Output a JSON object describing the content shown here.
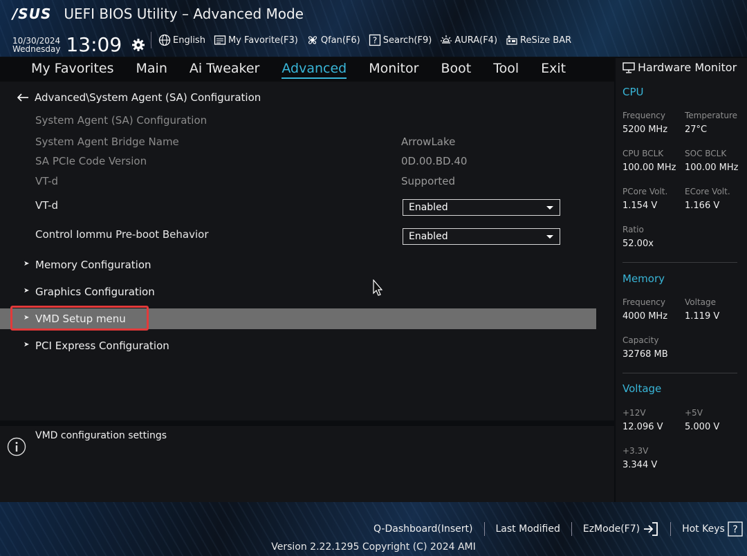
{
  "header": {
    "brand": "/SUS",
    "title": "UEFI BIOS Utility – Advanced Mode",
    "date": "10/30/2024",
    "weekday": "Wednesday",
    "time": "13:09"
  },
  "toolbar": [
    {
      "icon": "globe-icon",
      "label": "English"
    },
    {
      "icon": "favorite-icon",
      "label": "My Favorite(F3)"
    },
    {
      "icon": "fan-icon",
      "label": "Qfan(F6)"
    },
    {
      "icon": "search-icon",
      "label": "Search(F9)"
    },
    {
      "icon": "aura-icon",
      "label": "AURA(F4)"
    },
    {
      "icon": "resize-bar-icon",
      "label": "ReSize BAR"
    }
  ],
  "tabs": [
    "My Favorites",
    "Main",
    "Ai Tweaker",
    "Advanced",
    "Monitor",
    "Boot",
    "Tool",
    "Exit"
  ],
  "active_tab": "Advanced",
  "breadcrumb": "Advanced\\System Agent (SA) Configuration",
  "section_title": "System Agent (SA) Configuration",
  "info_rows": [
    {
      "label": "System Agent Bridge Name",
      "value": "ArrowLake"
    },
    {
      "label": "SA PCIe Code Version",
      "value": "0D.00.BD.40"
    },
    {
      "label": "VT-d",
      "value": "Supported"
    }
  ],
  "settings": [
    {
      "label": "VT-d",
      "value": "Enabled"
    },
    {
      "label": "Control Iommu Pre-boot Behavior",
      "value": "Enabled"
    }
  ],
  "submenus": [
    "Memory Configuration",
    "Graphics Configuration",
    "VMD Setup menu",
    "PCI Express Configuration"
  ],
  "selected_submenu": "VMD Setup menu",
  "help_text": "VMD configuration settings",
  "hardware_monitor": {
    "title": "Hardware Monitor",
    "cpu": {
      "heading": "CPU",
      "frequency_label": "Frequency",
      "frequency": "5200 MHz",
      "temperature_label": "Temperature",
      "temperature": "27°C",
      "cpu_bclk_label": "CPU BCLK",
      "cpu_bclk": "100.00 MHz",
      "soc_bclk_label": "SOC BCLK",
      "soc_bclk": "100.00 MHz",
      "pcore_label": "PCore Volt.",
      "pcore": "1.154 V",
      "ecore_label": "ECore Volt.",
      "ecore": "1.166 V",
      "ratio_label": "Ratio",
      "ratio": "52.00x"
    },
    "memory": {
      "heading": "Memory",
      "frequency_label": "Frequency",
      "frequency": "4000 MHz",
      "voltage_label": "Voltage",
      "voltage": "1.119 V",
      "capacity_label": "Capacity",
      "capacity": "32768 MB"
    },
    "voltage": {
      "heading": "Voltage",
      "v12_label": "+12V",
      "v12": "12.096 V",
      "v5_label": "+5V",
      "v5": "5.000 V",
      "v33_label": "+3.3V",
      "v33": "3.344 V"
    }
  },
  "bottom": {
    "qdashboard": "Q-Dashboard(Insert)",
    "last_modified": "Last Modified",
    "ezmode": "EzMode(F7)",
    "hotkeys": "Hot Keys",
    "version": "Version 2.22.1295 Copyright (C) 2024 AMI"
  },
  "colors": {
    "accent": "#39b6d8",
    "selection": "#6e6e6e",
    "highlight_box": "#e23a3a"
  }
}
